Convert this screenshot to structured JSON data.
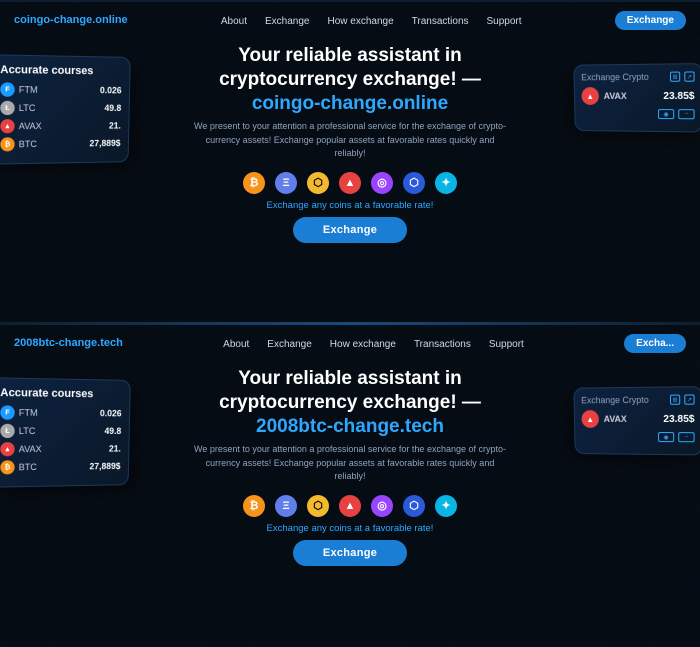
{
  "sections": [
    {
      "id": "section1",
      "logo": "coingo-change.online",
      "nav": {
        "links": [
          "About",
          "Exchange",
          "How exchange",
          "Transactions",
          "Support"
        ],
        "button": "Exchange"
      },
      "hero": {
        "headline_plain": "Your reliable assistant in cryptocurrency exchange! —",
        "headline_brand": "coingo-change.online",
        "body": "We present to your attention a professional service for the exchange of crypto-currency assets! Exchange popular assets at favorable rates quickly and reliably!"
      },
      "tagline": "Exchange any coins at a favorable rate!",
      "exchange_btn": "Exchange",
      "card_left": {
        "title": "Accurate courses",
        "coins": [
          {
            "symbol": "FTM",
            "price": "0.026",
            "color": "#1a9bff"
          },
          {
            "symbol": "LTC",
            "price": "49.8",
            "color": "#aaa"
          },
          {
            "symbol": "AVAX",
            "price": "21.",
            "color": "#e84142"
          },
          {
            "symbol": "BTC",
            "price": "27,889$",
            "color": "#f7931a"
          }
        ]
      },
      "card_right": {
        "title": "Exchange Crypto",
        "coin": "AVAX",
        "price": "23.85$",
        "coin_color": "#e84142"
      }
    },
    {
      "id": "section2",
      "logo": "2008btc-change.tech",
      "nav": {
        "links": [
          "About",
          "Exchange",
          "How exchange",
          "Transactions",
          "Support"
        ],
        "button": "Excha..."
      },
      "hero": {
        "headline_plain": "Your reliable assistant in cryptocurrency exchange! —",
        "headline_brand": "2008btc-change.tech",
        "body": "We present to your attention a professional service for the exchange of crypto-currency assets! Exchange popular assets at favorable rates quickly and reliably!"
      },
      "tagline": "Exchange any coins at a favorable rate!",
      "exchange_btn": "Exchange",
      "card_left": {
        "title": "Accurate courses",
        "coins": [
          {
            "symbol": "FTM",
            "price": "0.026",
            "color": "#1a9bff"
          },
          {
            "symbol": "LTC",
            "price": "49.8",
            "color": "#aaa"
          },
          {
            "symbol": "AVAX",
            "price": "21.",
            "color": "#e84142"
          },
          {
            "symbol": "BTC",
            "price": "27,889$",
            "color": "#f7931a"
          }
        ]
      },
      "card_right": {
        "title": "Exchange Crypto",
        "coin": "AVAX",
        "price": "23.85$",
        "coin_color": "#e84142"
      }
    }
  ],
  "coin_icons": [
    {
      "symbol": "₿",
      "class": "coin-btc"
    },
    {
      "symbol": "Ξ",
      "class": "coin-eth"
    },
    {
      "symbol": "⬡",
      "class": "coin-bnb"
    },
    {
      "symbol": "▲",
      "class": "coin-avax"
    },
    {
      "symbol": "◉",
      "class": "coin-sol"
    },
    {
      "symbol": "⬡",
      "class": "coin-link"
    },
    {
      "symbol": "✦",
      "class": "coin-xlm"
    }
  ]
}
